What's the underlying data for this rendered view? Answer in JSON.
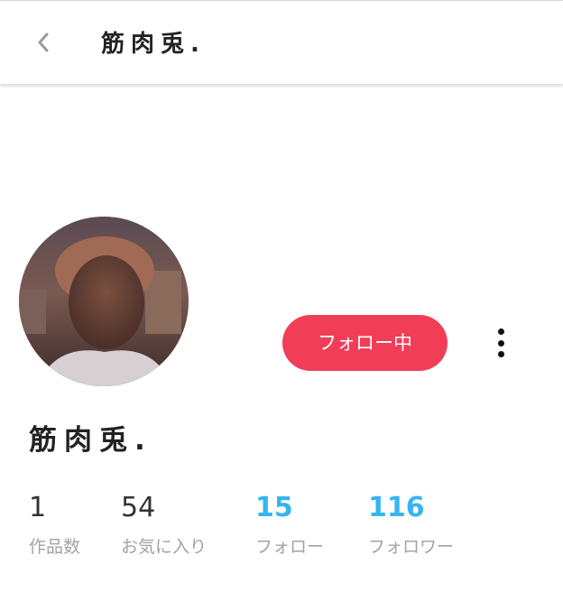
{
  "header": {
    "title": "筋肉兎.",
    "back_icon": "chevron-left-icon"
  },
  "profile": {
    "name": "筋肉兎.",
    "follow_button_label": "フォロー中",
    "more_icon": "vertical-ellipsis-icon"
  },
  "stats": [
    {
      "value": "1",
      "label": "作品数"
    },
    {
      "value": "54",
      "label": "お気に入り"
    },
    {
      "value": "15",
      "label": "フォロー"
    },
    {
      "value": "116",
      "label": "フォロワー"
    }
  ],
  "colors": {
    "accent_red": "#f23d57",
    "accent_blue": "#35b5f0",
    "label_gray": "#a3a3a3"
  }
}
